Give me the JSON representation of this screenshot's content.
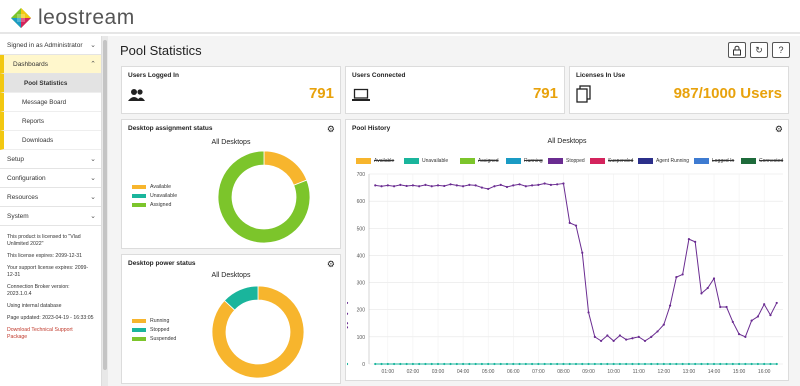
{
  "app": {
    "name": "leostream"
  },
  "sidebar": {
    "signed_in": "Signed in as Administrator",
    "dashboards": "Dashboards",
    "sub_items": [
      "Pool Statistics",
      "Message Board",
      "Reports",
      "Downloads"
    ],
    "sections": [
      "Setup",
      "Configuration",
      "Resources",
      "System"
    ],
    "info": {
      "license_to": "This product is licensed to \"Vlad Unlimited 2022\"",
      "license_expires": "This license expires: 2099-12-31",
      "support_expires": "Your support license expires: 2099-12-31",
      "broker_version": "Connection Broker version: 2023.1.0.4",
      "database": "Using internal database",
      "page_updated": "Page updated: 2023-04-19 - 16:33:05",
      "download_link": "Download Technical Support Package"
    }
  },
  "page": {
    "title": "Pool Statistics",
    "buttons": [
      {
        "icon": "lock-icon"
      },
      {
        "icon": "refresh-icon"
      },
      {
        "icon": "help-icon"
      }
    ]
  },
  "stats": {
    "users_logged_in": {
      "label": "Users Logged In",
      "value": "791",
      "icon": "users-icon"
    },
    "users_connected": {
      "label": "Users Connected",
      "value": "791",
      "icon": "laptop-icon"
    },
    "licenses_in_use": {
      "label": "Licenses In Use",
      "value": "987/1000 Users",
      "icon": "documents-icon"
    }
  },
  "assignment": {
    "title": "Desktop assignment status",
    "subtitle": "All Desktops",
    "legend": [
      {
        "label": "Available",
        "color": "#f7b52d"
      },
      {
        "label": "Unavailable",
        "color": "#1ab59c"
      },
      {
        "label": "Assigned",
        "color": "#7cc52b"
      }
    ]
  },
  "power": {
    "title": "Desktop power status",
    "subtitle": "All Desktops",
    "legend": [
      {
        "label": "Running",
        "color": "#f7b52d"
      },
      {
        "label": "Stopped",
        "color": "#1ab59c"
      },
      {
        "label": "Suspended",
        "color": "#7cc52b"
      }
    ]
  },
  "history": {
    "title": "Pool History",
    "subtitle": "All Desktops",
    "legend": [
      {
        "label": "Available",
        "color": "#f7b52d",
        "struck": true
      },
      {
        "label": "Unavailable",
        "color": "#1ab59c",
        "struck": false
      },
      {
        "label": "Assigned",
        "color": "#7cc52b",
        "struck": true
      },
      {
        "label": "Running",
        "color": "#1a9bc4",
        "struck": true
      },
      {
        "label": "Stopped",
        "color": "#6a2c91",
        "struck": false
      },
      {
        "label": "Suspended",
        "color": "#d4245d",
        "struck": true
      },
      {
        "label": "Agent Running",
        "color": "#2b2f8a",
        "struck": false
      },
      {
        "label": "Logged In",
        "color": "#3e7bd1",
        "struck": true
      },
      {
        "label": "Connected",
        "color": "#1e6b3b",
        "struck": true
      }
    ]
  },
  "chart_data": [
    {
      "type": "pie",
      "title": "All Desktops",
      "categories": [
        "Available",
        "Unavailable",
        "Assigned"
      ],
      "values": [
        19,
        0,
        81
      ],
      "colors": [
        "#f7b52d",
        "#1ab59c",
        "#7cc52b"
      ]
    },
    {
      "type": "pie",
      "title": "All Desktops",
      "categories": [
        "Running",
        "Stopped",
        "Suspended"
      ],
      "values": [
        87,
        13,
        0
      ],
      "colors": [
        "#f7b52d",
        "#1ab59c",
        "#7cc52b"
      ]
    },
    {
      "type": "line",
      "title": "All Desktops",
      "ylim": [
        0,
        700
      ],
      "yticks": [
        0,
        100,
        200,
        300,
        400,
        500,
        600,
        700
      ],
      "xticks": [
        "01:00",
        "02:00",
        "03:00",
        "04:00",
        "05:00",
        "06:00",
        "07:00",
        "08:00",
        "09:00",
        "10:00",
        "11:00",
        "12:00",
        "13:00",
        "14:00",
        "15:00",
        "16:00"
      ],
      "x": [
        0.5,
        0.75,
        1,
        1.25,
        1.5,
        1.75,
        2,
        2.25,
        2.5,
        2.75,
        3,
        3.25,
        3.5,
        3.75,
        4,
        4.25,
        4.5,
        4.75,
        5,
        5.25,
        5.5,
        5.75,
        6,
        6.25,
        6.5,
        6.75,
        7,
        7.25,
        7.5,
        7.75,
        8,
        8.25,
        8.5,
        8.75,
        9,
        9.25,
        9.5,
        9.75,
        10,
        10.25,
        10.5,
        10.75,
        11,
        11.25,
        11.5,
        11.75,
        12,
        12.25,
        12.5,
        12.75,
        13,
        13.25,
        13.5,
        13.75,
        14,
        14.25,
        14.5,
        14.75,
        15,
        15.25,
        15.5,
        15.75,
        16,
        16.25,
        16.5
      ],
      "series": [
        {
          "name": "Stopped",
          "color": "#6a2c91",
          "values": [
            658,
            655,
            658,
            655,
            660,
            656,
            658,
            655,
            660,
            655,
            658,
            656,
            662,
            658,
            655,
            660,
            658,
            650,
            645,
            655,
            660,
            652,
            658,
            662,
            655,
            658,
            660,
            665,
            660,
            662,
            665,
            520,
            510,
            410,
            190,
            100,
            85,
            105,
            85,
            105,
            90,
            95,
            100,
            85,
            100,
            120,
            145,
            215,
            320,
            330,
            460,
            450,
            260,
            280,
            315,
            210,
            210,
            155,
            110,
            100,
            160,
            175,
            220,
            180,
            225,
            150,
            185,
            135,
            225
          ]
        },
        {
          "name": "Unavailable",
          "color": "#1ab59c",
          "values": [
            0,
            0,
            0,
            0,
            0,
            0,
            0,
            0,
            0,
            0,
            0,
            0,
            0,
            0,
            0,
            0,
            0,
            0,
            0,
            0,
            0,
            0,
            0,
            0,
            0,
            0,
            0,
            0,
            0,
            0,
            0,
            0,
            0,
            0,
            0,
            0,
            0,
            0,
            0,
            0,
            0,
            0,
            0,
            0,
            0,
            0,
            0,
            0,
            0,
            0,
            0,
            0,
            0,
            0,
            0,
            0,
            0,
            0,
            0,
            0,
            0,
            0,
            0,
            0,
            0,
            0,
            0
          ]
        }
      ]
    }
  ]
}
